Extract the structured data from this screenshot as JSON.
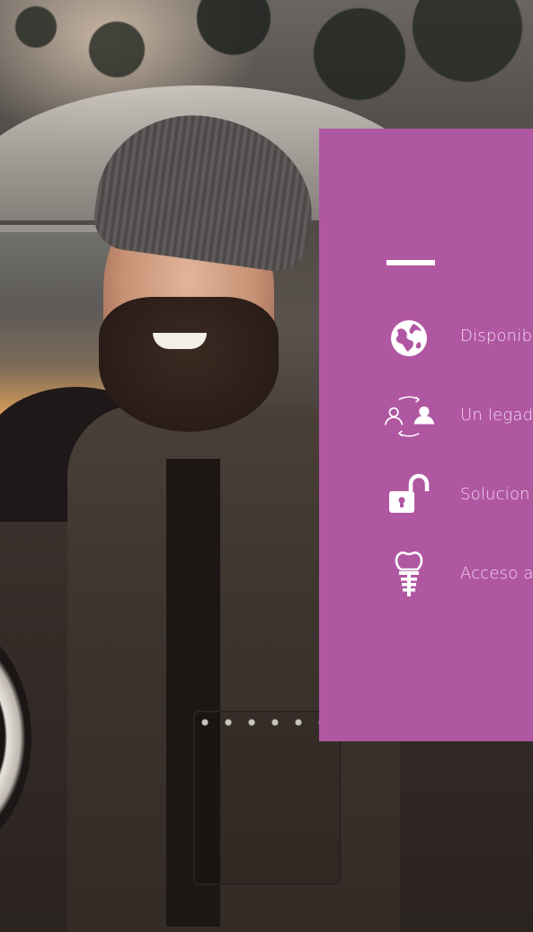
{
  "card": {
    "accent_color": "#b057a2",
    "features": [
      {
        "icon": "globe-icon",
        "label": "Disponib"
      },
      {
        "icon": "people-cycle-icon",
        "label": "Un legad"
      },
      {
        "icon": "open-lock-icon",
        "label": "Solucion"
      },
      {
        "icon": "dental-implant-icon",
        "label": "Acceso a"
      }
    ]
  }
}
